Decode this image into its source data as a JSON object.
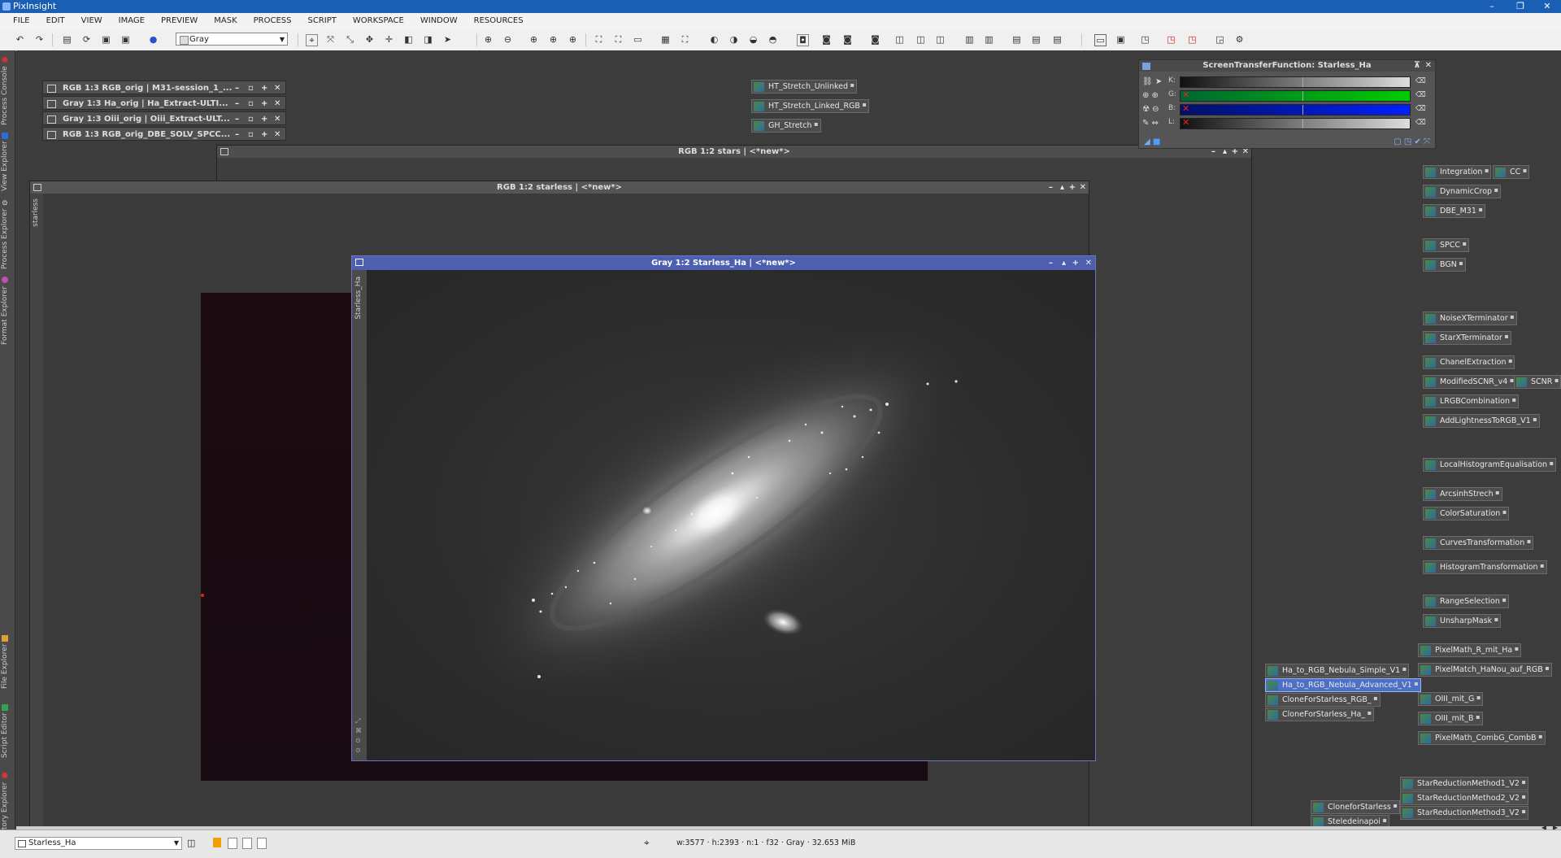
{
  "app": {
    "title": "PixInsight"
  },
  "menu": [
    "FILE",
    "EDIT",
    "VIEW",
    "IMAGE",
    "PREVIEW",
    "MASK",
    "PROCESS",
    "SCRIPT",
    "WORKSPACE",
    "WINDOW",
    "RESOURCES"
  ],
  "toolbar": {
    "mode_select": "Gray"
  },
  "side_tabs": [
    "Process Console",
    "View Explorer",
    "Process Explorer",
    "Format Explorer",
    "File Explorer",
    "Script Editor",
    "History Explorer"
  ],
  "iconized_windows": [
    "RGB 1:3 RGB_orig | M31-session_1_...",
    "Gray 1:3 Ha_orig | Ha_Extract-ULTI...",
    "Gray 1:3 Oiii_orig | Oiii_Extract-ULT...",
    "RGB 1:3 RGB_orig_DBE_SOLV_SPCC..."
  ],
  "windows": {
    "stars": {
      "title": "RGB 1:2 stars | <*new*>"
    },
    "starless": {
      "title": "RGB 1:2 starless | <*new*>",
      "side_label": "starless"
    },
    "active": {
      "title": "Gray 1:2 Starless_Ha | <*new*>",
      "side_label": "Starless_Ha"
    }
  },
  "process_icons_top": [
    "HT_Stretch_Unlinked",
    "HT_Stretch_Linked_RGB",
    "GH_Stretch"
  ],
  "stf": {
    "title": "ScreenTransferFunction: Starless_Ha",
    "channels": [
      "K:",
      "G:",
      "B:",
      "L:"
    ]
  },
  "process_icons_right": [
    "Integration",
    "CC",
    "DynamicCrop",
    "DBE_M31",
    "SPCC",
    "BGN",
    "NoiseXTerminator",
    "StarXTerminator",
    "ChanelExtraction",
    "ModifiedSCNR_v4",
    "SCNR",
    "LRGBCombination",
    "AddLightnessToRGB_V1",
    "LocalHistogramEqualisation",
    "ArcsinhStrech",
    "ColorSaturation",
    "CurvesTransformation",
    "HistogramTransformation",
    "RangeSelection",
    "UnsharpMask",
    "PixelMath_R_mit_Ha",
    "PixelMatch_HaNou_auf_RGB",
    "OIII_mit_G",
    "OIII_mit_B",
    "PixelMath_CombG_CombB",
    "StarReductionMethod1_V2",
    "StarReductionMethod2_V2",
    "StarReductionMethod3_V2"
  ],
  "process_icons_script": [
    "Ha_to_RGB_Nebula_Simple_V1",
    "Ha_to_RGB_Nebula_Advanced_V1",
    "CloneForStarless_RGB_",
    "CloneForStarless_Ha_"
  ],
  "process_icons_bottom": [
    "CloneforStarless",
    "Steledeinapoi"
  ],
  "status": {
    "view_select": "Starless_Ha",
    "info": "w:3577 · h:2393 · n:1 · f32 · Gray · 32.653 MiB"
  }
}
